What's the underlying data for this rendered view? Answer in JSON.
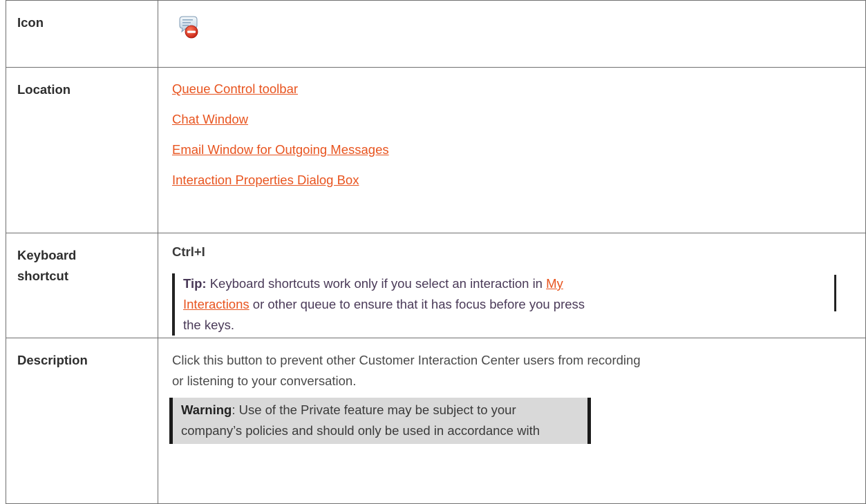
{
  "rows": {
    "icon": {
      "label": "Icon",
      "icon_name": "private-chat-bubble-icon"
    },
    "location": {
      "label": "Location",
      "links": [
        "Queue Control toolbar",
        "Chat Window",
        "Email Window for Outgoing Messages",
        "Interaction Properties Dialog Box"
      ]
    },
    "keyboard": {
      "label_line1": "Keyboard",
      "label_line2": "shortcut",
      "shortcut": "Ctrl+I",
      "tip_label": "Tip:",
      "tip_text_before": " Keyboard shortcuts work only if you select an interaction in ",
      "tip_link": "My Interactions",
      "tip_text_after": " or other queue to ensure that it has focus before you press the keys."
    },
    "description": {
      "label": "Description",
      "text": "Click this button to prevent other Customer Interaction Center users from recording or listening to your conversation.",
      "warning_label": "Warning",
      "warning_text": ": Use of the Private feature may be subject to your company’s policies and should only be used in accordance with"
    }
  },
  "colors": {
    "link": "#e8541f",
    "border": "#6f6f6f",
    "warning_bg": "#d9d9d9",
    "tip_text": "#4a3a58"
  }
}
